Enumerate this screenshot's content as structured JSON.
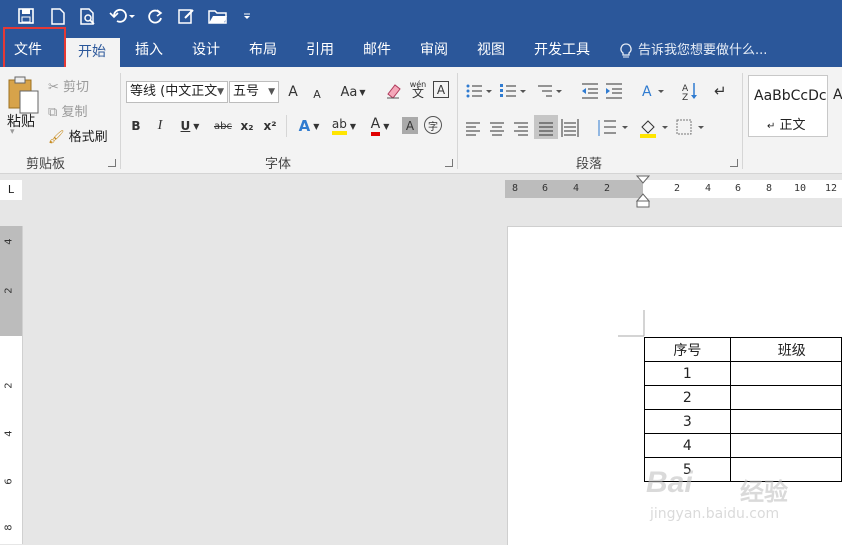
{
  "quick_access": {
    "icons": [
      "save-icon",
      "new-doc-icon",
      "print-preview-icon",
      "undo-icon",
      "redo-icon",
      "edit-icon",
      "open-folder-icon",
      "customize-icon"
    ]
  },
  "tabs": [
    {
      "label": "文件"
    },
    {
      "label": "开始"
    },
    {
      "label": "插入"
    },
    {
      "label": "设计"
    },
    {
      "label": "布局"
    },
    {
      "label": "引用"
    },
    {
      "label": "邮件"
    },
    {
      "label": "审阅"
    },
    {
      "label": "视图"
    },
    {
      "label": "开发工具"
    }
  ],
  "tellme": {
    "label": "告诉我您想要做什么..."
  },
  "clipboard": {
    "paste": "粘贴",
    "cut": "剪切",
    "copy": "复制",
    "format_painter": "格式刷",
    "group_label": "剪贴板"
  },
  "font": {
    "font_name": "等线 (中文正文",
    "font_size": "五号",
    "grow": "A",
    "shrink": "A",
    "case": "Aa",
    "wen": "wén",
    "wen_char": "文",
    "boxed": "A",
    "bold": "B",
    "italic": "I",
    "underline": "U",
    "strike": "abc",
    "sub": "x₂",
    "sup": "x²",
    "effect": "A",
    "highlight": "ab",
    "color": "A",
    "shade": "A",
    "circle": "字",
    "group_label": "字体"
  },
  "paragraph": {
    "group_label": "段落"
  },
  "styles": {
    "preview": "AaBbCcDc",
    "name": "正文",
    "next": "A"
  },
  "ruler": {
    "horizontal_left": [
      "8",
      "6",
      "4",
      "2"
    ],
    "horizontal_right": [
      "2",
      "4",
      "6",
      "8",
      "10",
      "12"
    ],
    "vertical": [
      "4",
      "2",
      "2",
      "4",
      "6",
      "8"
    ],
    "corner": "L"
  },
  "table": {
    "headers": [
      "序号",
      "班级"
    ],
    "rows": [
      [
        "1",
        ""
      ],
      [
        "2",
        ""
      ],
      [
        "3",
        ""
      ],
      [
        "4",
        ""
      ],
      [
        "5",
        ""
      ]
    ]
  },
  "watermark": {
    "brand": "Bai",
    "brand2": "经验",
    "url": "jingyan.baidu.com"
  },
  "colors": {
    "ribbon_blue": "#2b579a",
    "highlight_red": "#e53935",
    "font_color_red": "#e00000",
    "highlight_yellow": "#ffe500"
  }
}
